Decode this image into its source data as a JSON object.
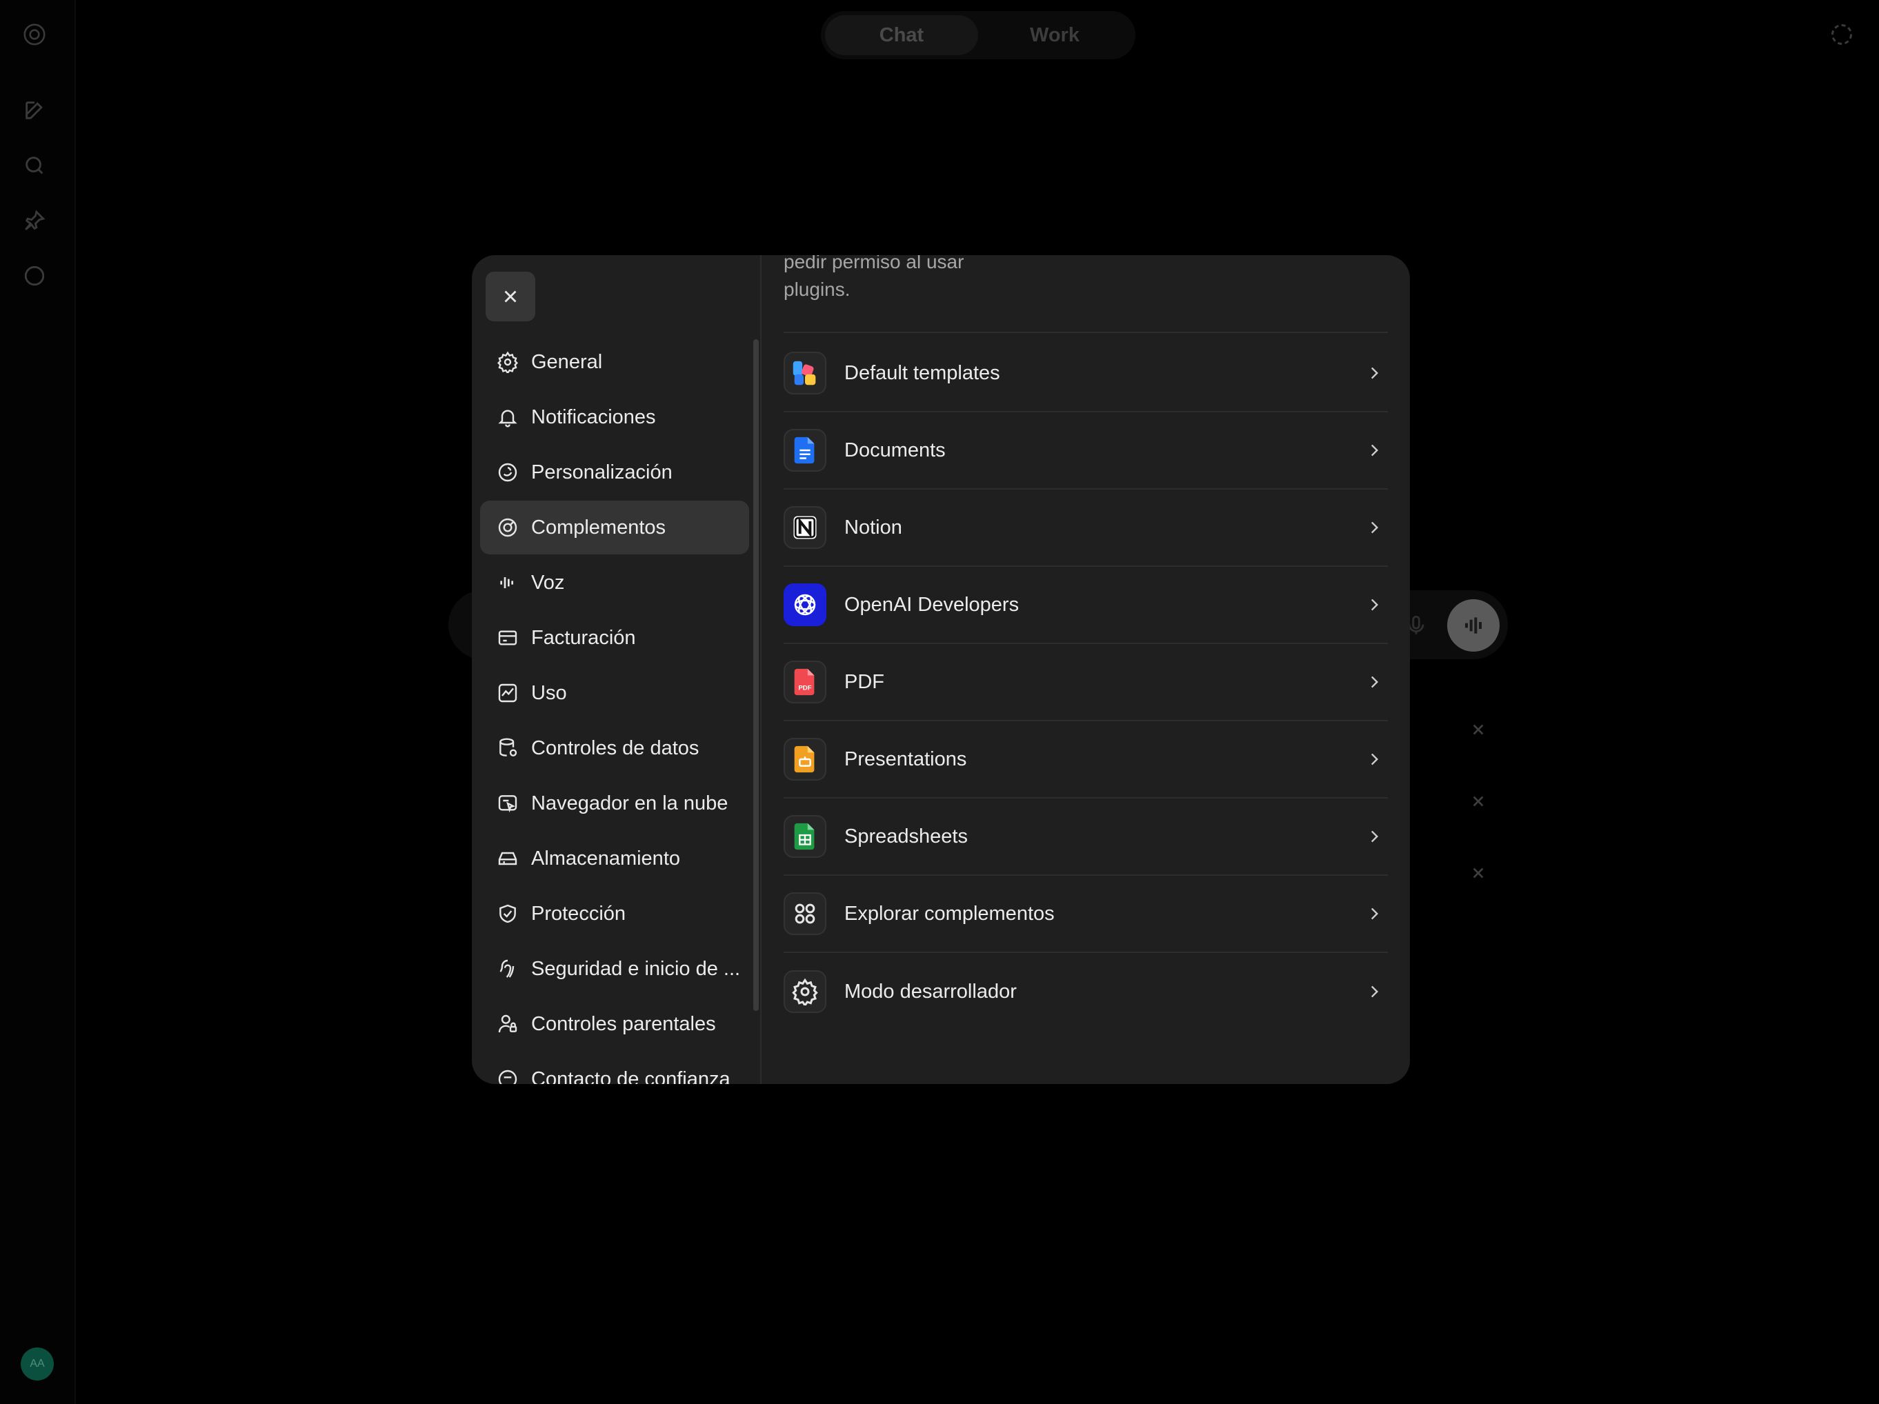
{
  "top_tabs": [
    {
      "label": "Chat",
      "active": true
    },
    {
      "label": "Work",
      "active": false
    }
  ],
  "rail": {
    "icons": [
      "openai-logo-icon",
      "new-chat-icon",
      "search-icon",
      "pin-icon",
      "chat-bubble-icon"
    ],
    "avatar_initials": "AA"
  },
  "settings": {
    "close_icon": "close-icon",
    "nav_items": [
      {
        "label": "General",
        "icon": "gear-icon",
        "active": false
      },
      {
        "label": "Notificaciones",
        "icon": "bell-icon",
        "active": false
      },
      {
        "label": "Personalización",
        "icon": "personalization-icon",
        "active": false
      },
      {
        "label": "Complementos",
        "icon": "plugins-icon",
        "active": true
      },
      {
        "label": "Voz",
        "icon": "voice-waveform-icon",
        "active": false
      },
      {
        "label": "Facturación",
        "icon": "credit-card-icon",
        "active": false
      },
      {
        "label": "Uso",
        "icon": "usage-chart-icon",
        "active": false
      },
      {
        "label": "Controles de datos",
        "icon": "database-icon",
        "active": false
      },
      {
        "label": "Navegador en la nube",
        "icon": "cloud-browser-icon",
        "active": false
      },
      {
        "label": "Almacenamiento",
        "icon": "storage-drive-icon",
        "active": false
      },
      {
        "label": "Protección",
        "icon": "shield-icon",
        "active": false
      },
      {
        "label": "Seguridad e inicio de ...",
        "icon": "security-login-icon",
        "active": false
      },
      {
        "label": "Controles parentales",
        "icon": "parental-icon",
        "active": false
      },
      {
        "label": "Contacto de confianza",
        "icon": "trusted-contact-icon",
        "active": false
      }
    ],
    "description_partial": "pedir permiso al usar plugins.",
    "plugins": [
      {
        "label": "Default templates",
        "icon": "default-templates-icon"
      },
      {
        "label": "Documents",
        "icon": "documents-icon"
      },
      {
        "label": "Notion",
        "icon": "notion-icon"
      },
      {
        "label": "OpenAI Developers",
        "icon": "openai-developers-icon"
      },
      {
        "label": "PDF",
        "icon": "pdf-icon",
        "badge": "PDF"
      },
      {
        "label": "Presentations",
        "icon": "presentations-icon"
      },
      {
        "label": "Spreadsheets",
        "icon": "spreadsheets-icon"
      },
      {
        "label": "Explorar complementos",
        "icon": "explore-grid-icon"
      },
      {
        "label": "Modo desarrollador",
        "icon": "developer-gear-icon"
      }
    ]
  },
  "colors": {
    "background": "#000000",
    "modal": "#1f1f1f",
    "nav_active": "#343434",
    "text": "#ececec",
    "muted_text": "#a6a6a6",
    "divider": "#2e2e2e"
  }
}
